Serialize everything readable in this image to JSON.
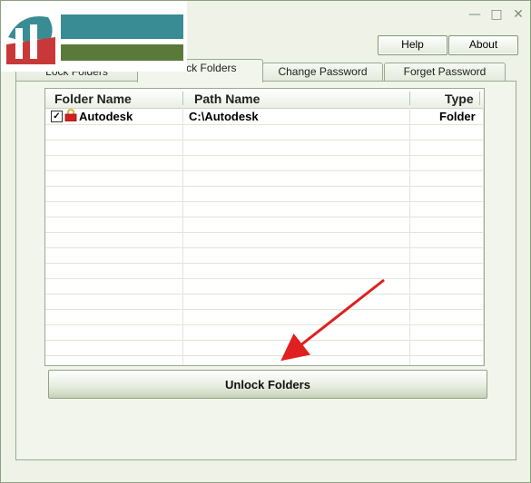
{
  "window": {
    "buttons": {
      "help_label": "Help",
      "about_label": "About"
    },
    "controls": [
      "minimize-icon",
      "maximize-icon",
      "close-icon"
    ]
  },
  "tabs": [
    {
      "label": "Lock Folders",
      "active": false
    },
    {
      "label": "Unlock Folders",
      "active": true
    },
    {
      "label": "Change Password",
      "active": false
    },
    {
      "label": "Forget Password",
      "active": false
    }
  ],
  "list": {
    "columns": [
      "Folder Name",
      "Path Name",
      "Type"
    ],
    "rows": [
      {
        "checked": true,
        "folder": "Autodesk",
        "path": "C:\\Autodesk",
        "type": "Folder"
      }
    ]
  },
  "action": {
    "unlock_label": "Unlock Folders"
  },
  "colors": {
    "accent_green": "#8ea482",
    "arrow_red": "#e02020",
    "logo_teal": "#3a8c94",
    "logo_green": "#5a7a3a",
    "logo_red": "#c83838"
  }
}
